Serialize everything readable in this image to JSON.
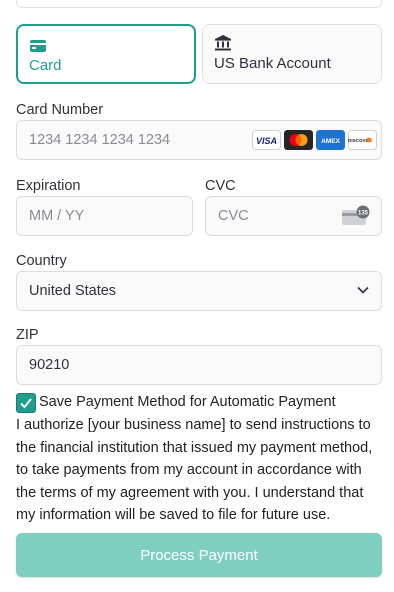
{
  "tabs": [
    {
      "label": "Card",
      "icon": "card-icon",
      "selected": true
    },
    {
      "label": "US Bank Account",
      "icon": "bank-icon",
      "selected": false
    }
  ],
  "card_number": {
    "label": "Card Number",
    "placeholder": "1234 1234 1234 1234",
    "brands": [
      "VISA",
      "mastercard",
      "AMEX",
      "DISCOVER"
    ]
  },
  "expiration": {
    "label": "Expiration",
    "placeholder": "MM / YY"
  },
  "cvc": {
    "label": "CVC",
    "placeholder": "CVC",
    "badge": "135"
  },
  "country": {
    "label": "Country",
    "value": "United States"
  },
  "zip": {
    "label": "ZIP",
    "value": "90210"
  },
  "save_payment": {
    "label": "Save Payment Method for Automatic Payment",
    "checked": true
  },
  "authorization_text": "I authorize [your business name] to send instructions to the financial institution that issued my payment method, to take payments from my account in accordance with the terms of my agreement with you. I understand that my information will be saved to file for future use.",
  "process_button": "Process Payment",
  "colors": {
    "accent": "#1f9e8f",
    "button": "#7fcfc0"
  }
}
